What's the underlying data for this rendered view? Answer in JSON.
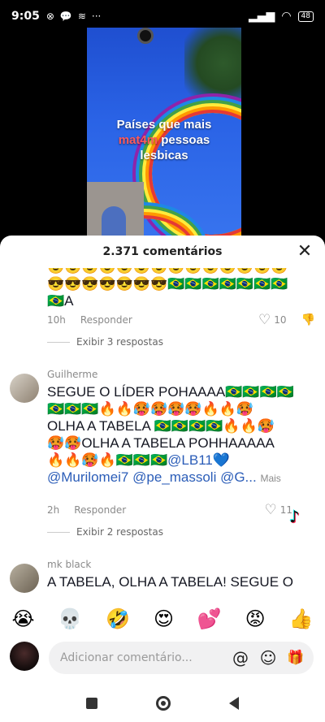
{
  "status_bar": {
    "time": "9:05",
    "battery": "48"
  },
  "video": {
    "caption_line1": "Países que mais",
    "caption_highlight": "mat4m",
    "caption_line2": " pessoas",
    "caption_line3": "lesbicas"
  },
  "sheet": {
    "title": "2.371 comentários"
  },
  "comments": [
    {
      "text_line1": "😎😎😎😎😎😎😎😎😎😎😎😎😎😎",
      "text_line2": "😎😎😎😎😎😎😎🇧🇷🇧🇷🇧🇷🇧🇷🇧🇷🇧🇷🇧🇷",
      "text_line3": "🇧🇷A",
      "time": "10h",
      "reply_label": "Responder",
      "likes": "10",
      "view_replies": "Exibir 3 respostas"
    },
    {
      "username": "Guilherme",
      "text_line1": "SEGUE O LÍDER POHAAAA🇧🇷🇧🇷🇧🇷🇧🇷",
      "text_line2": "🇧🇷🇧🇷🇧🇷🔥🔥🥵🥵🥵🥵🔥🔥🥵",
      "text_line3": "OLHA A TABELA 🇧🇷🇧🇷🇧🇷🇧🇷🔥🔥🥵",
      "text_line4": "🥵🥵OLHA A TABELA POHHAAAAA",
      "text_line5_prefix": "🔥🔥🥵🔥🇧🇷🇧🇷🇧🇷",
      "text_line5_mention": "@LB11💙",
      "text_line6": "@Murilomei7 @pe_massoli @G...",
      "more_label": "Mais",
      "time": "2h",
      "reply_label": "Responder",
      "likes": "11",
      "view_replies": "Exibir 2 respostas"
    },
    {
      "username": "mk black",
      "text_line1": "A TABELA, OLHA A TABELA! SEGUE O"
    }
  ],
  "emoji_bar": [
    "😭",
    "💀",
    "🤣",
    "😍",
    "💕",
    "😡",
    "👍"
  ],
  "input": {
    "placeholder": "Adicionar comentário...",
    "mention_icon": "@",
    "emoji_icon": "☺",
    "gift_icon": "🎁"
  },
  "icons": {
    "close": "✕",
    "heart": "♡",
    "dislike": "👎"
  }
}
